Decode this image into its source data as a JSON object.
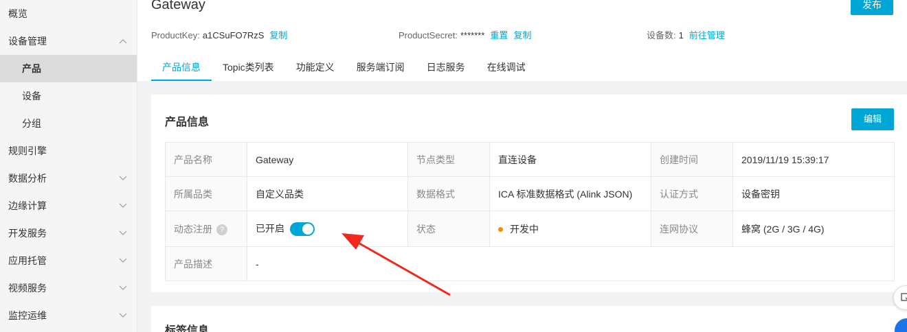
{
  "sidebar": {
    "items": [
      {
        "label": "概览"
      },
      {
        "label": "设备管理"
      },
      {
        "label": "产品"
      },
      {
        "label": "设备"
      },
      {
        "label": "分组"
      },
      {
        "label": "规则引擎"
      },
      {
        "label": "数据分析"
      },
      {
        "label": "边缘计算"
      },
      {
        "label": "开发服务"
      },
      {
        "label": "应用托管"
      },
      {
        "label": "视频服务"
      },
      {
        "label": "监控运维"
      }
    ]
  },
  "header": {
    "title": "Gateway",
    "publish_label": "发布",
    "product_key_label": "ProductKey:",
    "product_key_value": "a1CSuFO7RzS",
    "copy_label": "复制",
    "product_secret_label": "ProductSecret:",
    "product_secret_value": "*******",
    "reset_label": "重置",
    "device_count_label": "设备数:",
    "device_count_value": "1",
    "goto_manage_label": "前往管理",
    "tabs": [
      {
        "label": "产品信息"
      },
      {
        "label": "Topic类列表"
      },
      {
        "label": "功能定义"
      },
      {
        "label": "服务端订阅"
      },
      {
        "label": "日志服务"
      },
      {
        "label": "在线调试"
      }
    ]
  },
  "product_info": {
    "title": "产品信息",
    "edit_label": "编辑",
    "rows": [
      [
        {
          "label": "产品名称",
          "value": "Gateway"
        },
        {
          "label": "节点类型",
          "value": "直连设备"
        },
        {
          "label": "创建时间",
          "value": "2019/11/19 15:39:17"
        }
      ],
      [
        {
          "label": "所属品类",
          "value": "自定义品类"
        },
        {
          "label": "数据格式",
          "value": "ICA 标准数据格式 (Alink JSON)"
        },
        {
          "label": "认证方式",
          "value": "设备密钥"
        }
      ],
      [
        {
          "label": "动态注册",
          "value": "已开启"
        },
        {
          "label": "状态",
          "value": "开发中"
        },
        {
          "label": "连网协议",
          "value": "蜂窝 (2G / 3G / 4G)"
        }
      ],
      [
        {
          "label": "产品描述",
          "value": "-"
        }
      ]
    ],
    "help_mark": "?",
    "status_color": "#ff8a00"
  },
  "tag_info": {
    "title": "标签信息"
  },
  "colors": {
    "accent": "#00a6d6",
    "annotation_arrow": "#f0281e"
  }
}
